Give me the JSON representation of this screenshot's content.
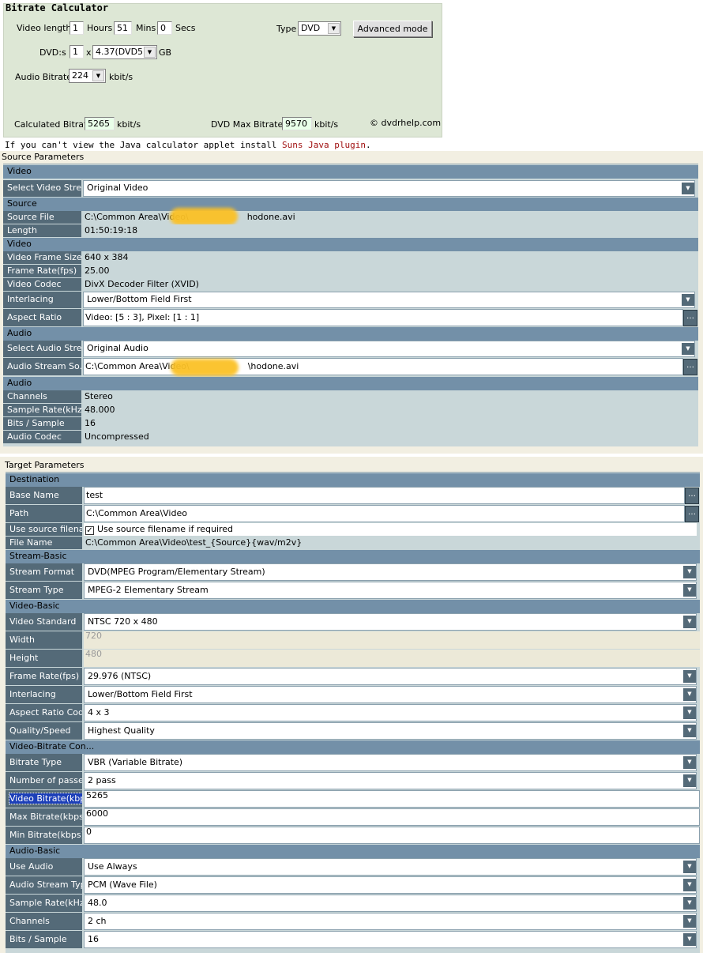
{
  "calculator": {
    "title": "Bitrate Calculator",
    "video_length_label": "Video length",
    "hours_value": "1",
    "hours_label": "Hours",
    "mins_value": "51",
    "mins_label": "Mins",
    "secs_value": "0",
    "secs_label": "Secs",
    "type_label": "Type",
    "type_value": "DVD",
    "advanced_button": "Advanced mode",
    "dvds_label": "DVD:s",
    "dvds_value": "1",
    "times": "x",
    "disc_size_value": "4.37(DVD5)",
    "disc_unit": "GB",
    "audio_bitrate_label": "Audio Bitrate",
    "audio_bitrate_value": "224",
    "audio_unit": "kbit/s",
    "calc_bitrate_label": "Calculated Bitrate",
    "calc_bitrate_value": "5265",
    "calc_unit": "kbit/s",
    "dvd_max_label": "DVD Max Bitrate",
    "dvd_max_value": "9570",
    "dvd_max_unit": "kbit/s",
    "credit": "© dvdrhelp.com"
  },
  "java_note": {
    "text": "If you can't view the Java calculator applet install ",
    "link": "Suns Java plugin",
    "end": "."
  },
  "source": {
    "title": "Source Parameters",
    "sec_video": "Video",
    "select_video_label": "Select Video Stre...",
    "select_video_value": "Original Video",
    "sec_source": "Source",
    "source_file_label": "Source File",
    "source_file_prefix": "C:\\Common Area\\Video\\",
    "source_file_suffix": "hodone.avi",
    "length_label": "Length",
    "length_value": "01:50:19:18",
    "sec_video2": "Video",
    "frame_size_label": "Video Frame Size",
    "frame_size_value": "640 x 384",
    "frame_rate_label": "Frame Rate(fps)",
    "frame_rate_value": "25.00",
    "codec_label": "Video Codec",
    "codec_value": "DivX Decoder Filter  (XVID)",
    "interlacing_label": "Interlacing",
    "interlacing_value": "Lower/Bottom Field First",
    "aspect_label": "Aspect Ratio",
    "aspect_value": "Video: [5 : 3], Pixel: [1 : 1]",
    "sec_audio": "Audio",
    "select_audio_label": "Select Audio Stre...",
    "select_audio_value": "Original Audio",
    "audio_source_label": "Audio Stream So...",
    "audio_source_prefix": "C:\\Common Area\\Video\\",
    "audio_source_suffix": "\\hodone.avi",
    "sec_audio2": "Audio",
    "channels_label": "Channels",
    "channels_value": "Stereo",
    "sample_rate_label": "Sample Rate(kHz)",
    "sample_rate_value": "48.000",
    "bits_label": "Bits / Sample",
    "bits_value": "16",
    "audio_codec_label": "Audio Codec",
    "audio_codec_value": "Uncompressed"
  },
  "target": {
    "title": "Target Parameters",
    "sec_destination": "Destination",
    "base_name_label": "Base Name",
    "base_name_value": "test",
    "path_label": "Path",
    "path_value": "C:\\Common Area\\Video",
    "use_source_label": "Use source filena...",
    "use_source_value": "Use source filename if required",
    "file_name_label": "File Name",
    "file_name_value": "C:\\Common Area\\Video\\test_{Source}{wav/m2v}",
    "sec_stream_basic": "Stream-Basic",
    "stream_format_label": "Stream Format",
    "stream_format_value": "DVD(MPEG Program/Elementary Stream)",
    "stream_type_label": "Stream Type",
    "stream_type_value": "MPEG-2 Elementary Stream",
    "sec_video_basic": "Video-Basic",
    "video_standard_label": "Video Standard",
    "video_standard_value": "NTSC 720 x 480",
    "width_label": "Width",
    "width_value": "720",
    "height_label": "Height",
    "height_value": "480",
    "frame_rate_label": "Frame Rate(fps)",
    "frame_rate_value": "29.976 (NTSC)",
    "interlacing_label": "Interlacing",
    "interlacing_value": "Lower/Bottom Field First",
    "aspect_code_label": "Aspect Ratio Code",
    "aspect_code_value": "4 x 3",
    "quality_label": "Quality/Speed",
    "quality_value": "Highest Quality",
    "sec_video_bitrate": "Video-Bitrate Con...",
    "bitrate_type_label": "Bitrate Type",
    "bitrate_type_value": "VBR (Variable Bitrate)",
    "passes_label": "Number of passes",
    "passes_value": "2 pass",
    "video_bitrate_label": "Video Bitrate(kbps)",
    "video_bitrate_value": "5265",
    "max_bitrate_label": "Max Bitrate(kbps)",
    "max_bitrate_value": "6000",
    "min_bitrate_label": "Min Bitrate(kbps)",
    "min_bitrate_value": "0",
    "sec_audio_basic": "Audio-Basic",
    "use_audio_label": "Use Audio",
    "use_audio_value": "Use Always",
    "audio_type_label": "Audio Stream Type",
    "audio_type_value": "PCM (Wave File)",
    "sample_rate_label": "Sample Rate(kHz)",
    "sample_rate_value": "48.0",
    "channels_label": "Channels",
    "channels_value": "2 ch",
    "bits_label": "Bits / Sample",
    "bits_value": "16"
  }
}
